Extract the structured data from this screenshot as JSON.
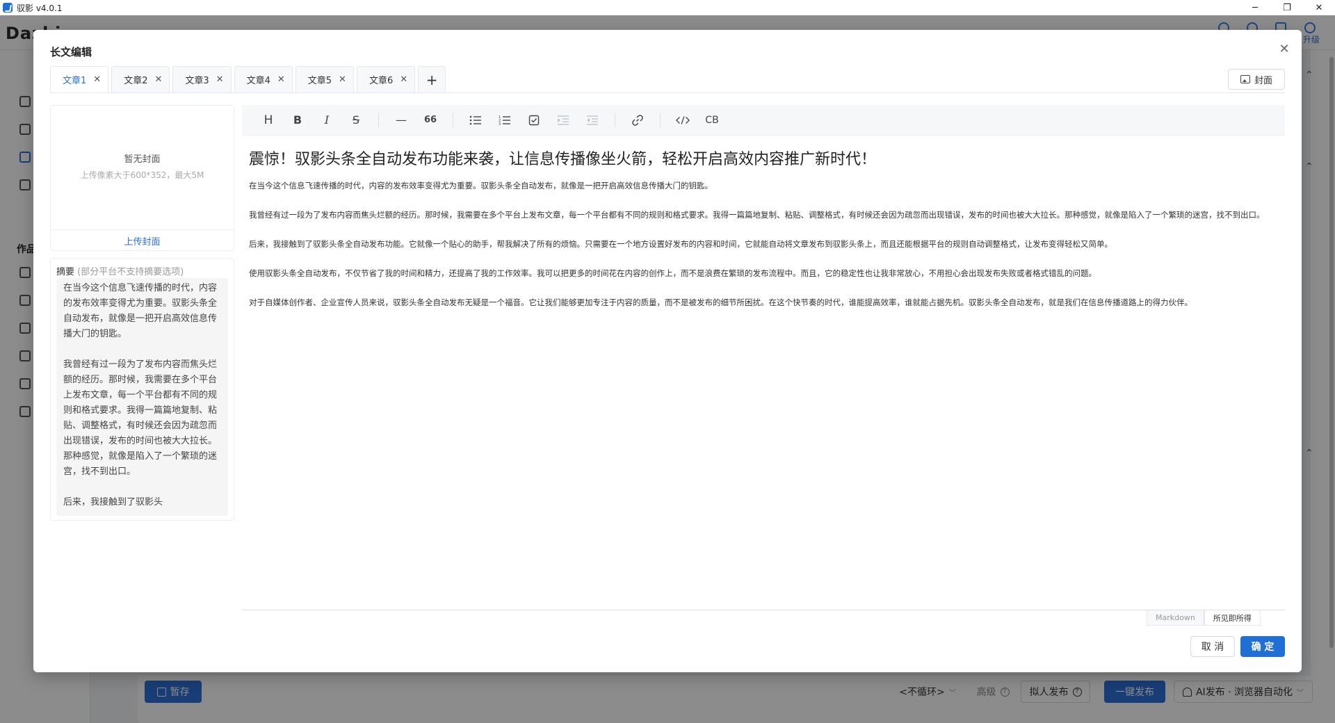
{
  "window": {
    "title": "驭影 v4.0.1",
    "controls": [
      "─",
      "❐",
      "✕"
    ]
  },
  "background": {
    "logo": "Dazhi",
    "upgrade_label": "升级",
    "sidebar_group": "作品",
    "footer": {
      "save_label": "暂存",
      "loop_select": "<不循环>",
      "advanced_label": "高级",
      "human_publish_label": "拟人发布",
      "one_click_publish_label": "一键发布",
      "ai_publish_label": "AI发布 · 浏览器自动化"
    }
  },
  "modal": {
    "title": "长文编辑",
    "tabs": [
      {
        "label": "文章1",
        "active": true
      },
      {
        "label": "文章2"
      },
      {
        "label": "文章3"
      },
      {
        "label": "文章4"
      },
      {
        "label": "文章5"
      },
      {
        "label": "文章6"
      }
    ],
    "add_tab_label": "+",
    "cover_button_label": "封面",
    "cover": {
      "empty_text": "暂无封面",
      "hint": "上传像素大于600*352，最大5M",
      "upload_label": "上传封面"
    },
    "summary": {
      "label": "摘要",
      "note": "(部分平台不支持摘要选项)",
      "text": "在当今这个信息飞速传播的时代，内容的发布效率变得尤为重要。驭影头条全自动发布，就像是一把开启高效信息传播大门的钥匙。\n\n我曾经有过一段为了发布内容而焦头烂额的经历。那时候，我需要在多个平台上发布文章，每一个平台都有不同的规则和格式要求。我得一篇篇地复制、粘贴、调整格式，有时候还会因为疏忽而出现错误，发布的时间也被大大拉长。那种感觉，就像是陷入了一个繁琐的迷宫，找不到出口。\n\n后来，我接触到了驭影头"
    },
    "toolbar": {
      "heading": "H",
      "bold": "B",
      "italic": "I",
      "strike": "S",
      "quote": "66",
      "codeblock": "CB"
    },
    "document": {
      "title": "震惊！驭影头条全自动发布功能来袭，让信息传播像坐火箭，轻松开启高效内容推广新时代！",
      "paragraphs": [
        "在当今这个信息飞速传播的时代，内容的发布效率变得尤为重要。驭影头条全自动发布，就像是一把开启高效信息传播大门的钥匙。",
        "我曾经有过一段为了发布内容而焦头烂额的经历。那时候，我需要在多个平台上发布文章，每一个平台都有不同的规则和格式要求。我得一篇篇地复制、粘贴、调整格式，有时候还会因为疏忽而出现错误，发布的时间也被大大拉长。那种感觉，就像是陷入了一个繁琐的迷宫，找不到出口。",
        "后来，我接触到了驭影头条全自动发布功能。它就像一个贴心的助手，帮我解决了所有的烦恼。只需要在一个地方设置好发布的内容和时间，它就能自动将文章发布到驭影头条上，而且还能根据平台的规则自动调整格式，让发布变得轻松又简单。",
        "使用驭影头条全自动发布，不仅节省了我的时间和精力，还提高了我的工作效率。我可以把更多的时间花在内容的创作上，而不是浪费在繁琐的发布流程中。而且，它的稳定性也让我非常放心，不用担心会出现发布失败或者格式错乱的问题。",
        "对于自媒体创作者、企业宣传人员来说，驭影头条全自动发布无疑是一个福音。它让我们能够更加专注于内容的质量，而不是被发布的细节所困扰。在这个快节奏的时代，谁能提高效率，谁就能占据先机。驭影头条全自动发布，就是我们在信息传播道路上的得力伙伴。"
      ]
    },
    "modes": [
      {
        "label": "Markdown"
      },
      {
        "label": "所见即所得",
        "active": true
      }
    ],
    "cancel_label": "取 消",
    "confirm_label": "确 定"
  }
}
